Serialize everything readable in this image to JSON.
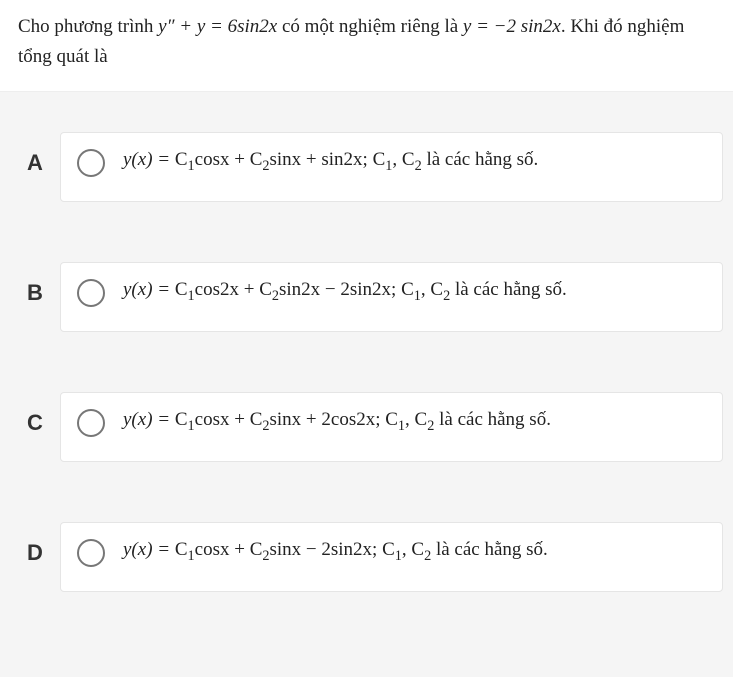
{
  "question": {
    "line1_pre": "Cho phương trình  ",
    "line1_math": "y″ + y = 6sin2x",
    "line1_mid": " có một nghiệm riêng là ",
    "line1_math2": "y = −2 sin2x",
    "line1_post": ". Khi đó nghiệm",
    "line2": "tổng quát là"
  },
  "options": [
    {
      "letter": "A",
      "prefix": "y(x) = ",
      "body_html": "C<sub>1</sub>cosx + C<sub>2</sub>sinx + sin2x; C<sub>1</sub>, C<sub>2</sub> là các hằng số."
    },
    {
      "letter": "B",
      "prefix": "y(x) = ",
      "body_html": "C<sub>1</sub>cos2x + C<sub>2</sub>sin2x − 2sin2x; C<sub>1</sub>, C<sub>2</sub> là các hằng số."
    },
    {
      "letter": "C",
      "prefix": "y(x) = ",
      "body_html": "C<sub>1</sub>cosx + C<sub>2</sub>sinx + 2cos2x; C<sub>1</sub>, C<sub>2</sub> là các hằng số."
    },
    {
      "letter": "D",
      "prefix": "y(x) = ",
      "body_html": "C<sub>1</sub>cosx + C<sub>2</sub>sinx − 2sin2x;  C<sub>1</sub>, C<sub>2</sub> là các hằng số."
    }
  ]
}
